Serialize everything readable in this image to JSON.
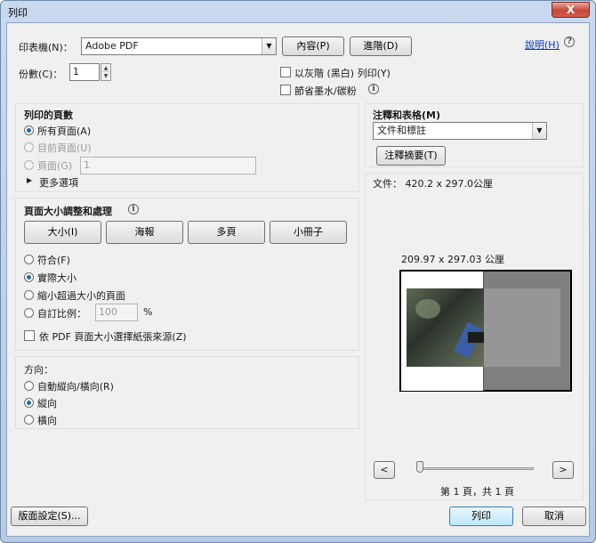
{
  "window": {
    "title": "列印",
    "close_label": "X"
  },
  "printer": {
    "label": "印表機(N)：",
    "value": "Adobe PDF",
    "properties_button": "內容(P)",
    "advanced_button": "進階(D)",
    "help_link": "說明(H)"
  },
  "copies": {
    "label": "份數(C)：",
    "value": "1"
  },
  "options": {
    "grayscale_label": "以灰階 (黑白) 列印(Y)",
    "save_ink_label": "節省墨水/碳粉"
  },
  "pages": {
    "title": "列印的頁數",
    "all_label": "所有頁面(A)",
    "current_label": "目前頁面(U)",
    "range_label": "頁面(G)",
    "range_value": "1",
    "more_options_label": "更多選項"
  },
  "sizing": {
    "title": "頁面大小調整和處理",
    "tabs": [
      "大小(I)",
      "海報",
      "多頁",
      "小冊子"
    ],
    "fit_label": "符合(F)",
    "actual_label": "實際大小",
    "shrink_label": "縮小超過大小的頁面",
    "custom_label": "自訂比例：",
    "custom_value": "100",
    "percent": "%",
    "pdf_paper_label": "依 PDF 頁面大小選擇紙張來源(Z)"
  },
  "orientation": {
    "title": "方向：",
    "auto_label": "自動縱向/橫向(R)",
    "portrait_label": "縱向",
    "landscape_label": "橫向"
  },
  "comments": {
    "title": "注釋和表格(M)",
    "select_value": "文件和標註",
    "summary_button": "注釋摘要(T)"
  },
  "preview": {
    "doc_size": "文件： 420.2 x 297.0公厘",
    "paper_size": "209.97 x 297.03 公厘",
    "prev_button": "<",
    "next_button": ">",
    "page_status": "第 1 頁，共 1 頁"
  },
  "footer": {
    "page_setup_button": "版面設定(S)...",
    "print_button": "列印",
    "cancel_button": "取消"
  }
}
